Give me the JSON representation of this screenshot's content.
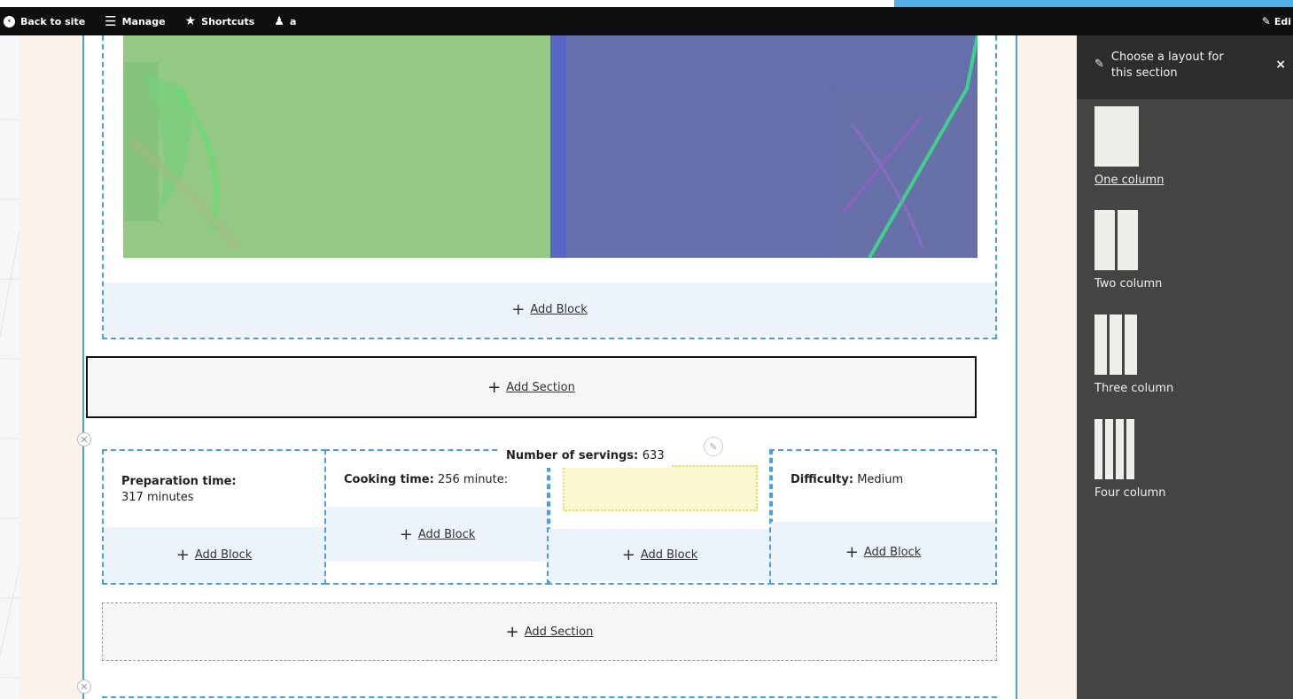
{
  "toolbar": {
    "back_label": "Back to site",
    "manage_label": "Manage",
    "shortcuts_label": "Shortcuts",
    "user_label": "a",
    "edit_label": "Edi"
  },
  "sections": {
    "top_add_block": "Add Block",
    "add_section_1": "Add Section",
    "add_section_2": "Add Section"
  },
  "columns": [
    {
      "label": "Preparation time:",
      "value": "317 minutes",
      "add_block": "Add Block"
    },
    {
      "label": "Cooking time:",
      "value": "256 minute:",
      "add_block": "Add Block"
    },
    {
      "label": "Number of servings:",
      "value": "633",
      "add_block": "Add Block"
    },
    {
      "label": "Difficulty:",
      "value": "Medium",
      "add_block": "Add Block"
    }
  ],
  "panel": {
    "title": "Choose a layout for this section",
    "close": "×",
    "options": [
      {
        "label": "One column"
      },
      {
        "label": "Two column"
      },
      {
        "label": "Three column"
      },
      {
        "label": "Four column"
      }
    ]
  },
  "colors": {
    "accent_blue": "#4a9fe0",
    "panel_bg": "#444444",
    "toolbar_bg": "#0f0f0f"
  }
}
